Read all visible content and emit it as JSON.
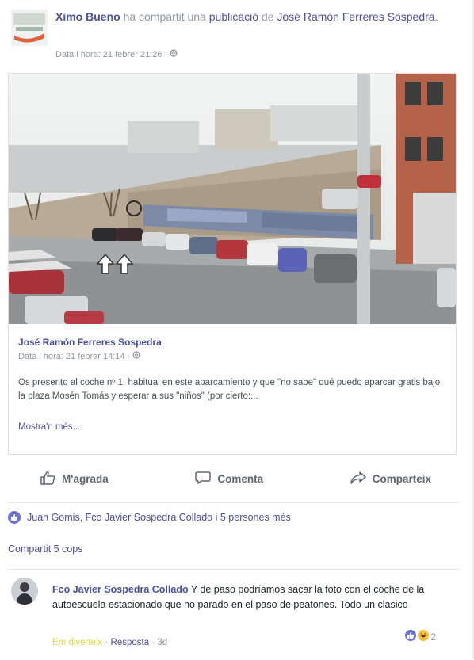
{
  "header": {
    "author": "Ximo Bueno",
    "shared_text": "ha compartit una",
    "publication": "publicació",
    "of": "de",
    "original_author": "José Ramón Ferreres Sospedra",
    "period": ".",
    "timestamp": "Data i hora: 21 febrer 21:26",
    "dot": "·"
  },
  "shared_post": {
    "author": "José Ramón Ferreres Sospedra",
    "timestamp": "Data i hora: 21 febrer 14:14",
    "dot": "·",
    "text": "Os presento al coche nº 1: habitual en este aparcamiento y que \"no sabe\" qué puedo aparcar gratis bajo la plaza Mosén Tomás y esperar a sus \"niños\" (por cierto:...",
    "more": "Mostra'n més..."
  },
  "actions": {
    "like": "M'agrada",
    "comment": "Comenta",
    "share": "Comparteix"
  },
  "reactions": {
    "text": "Juan Gomis, Fco Javier Sospedra Collado i 5 persones més"
  },
  "shares": {
    "text": "Compartit 5 cops"
  },
  "comment": {
    "author": "Fco Javier Sospedra Collado",
    "text": "Y de paso podríamos sacar la foto con el coche de la autoescuela estacionado que no parado en el paso de peatones. Todo un clasico",
    "tag": "Em diverteix",
    "sep": "·",
    "reply": "Resposta",
    "age": "3d",
    "reaction_count": "2"
  },
  "colors": {
    "link": "#4b4f9c",
    "meta": "#9197a3",
    "accent": "#6b6fd6"
  }
}
